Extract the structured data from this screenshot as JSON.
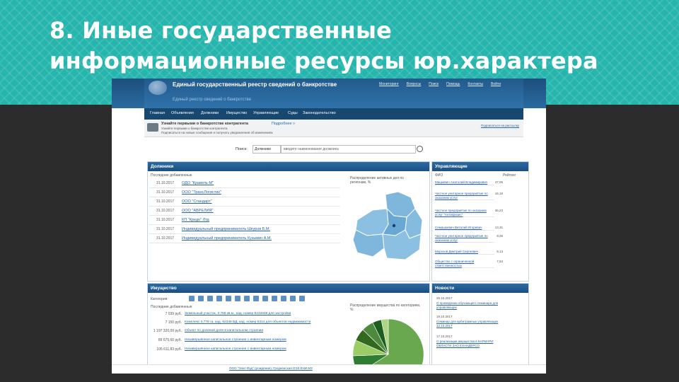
{
  "slide": {
    "title_line1": "8. Иные государственные",
    "title_line2": "информационные ресурсы юр.характера"
  },
  "site": {
    "title": "Единый государственный реестр сведений о банкротстве",
    "subtitle": "Единый реестр сведений о банкротстве",
    "top_links": [
      "Мониторинг",
      "Вопросы",
      "Поиск",
      "Помощь",
      "Контакты",
      "Войти"
    ],
    "nav": [
      "Главная",
      "Объявления",
      "Должники",
      "Имущество",
      "Управляющие",
      "Суды",
      "Законодательство"
    ]
  },
  "banner": {
    "title": "Узнайте первыми о банкротстве контрагента",
    "more": "Подробнее »",
    "line2": "Узнайте первыми о банкротстве контрагента",
    "line3": "Подписаться на новые сообщения и получать уведомления об изменениях",
    "right_link": "Подписаться на рассылку"
  },
  "search": {
    "label": "Поиск:",
    "scope": "Должники",
    "placeholder": "введите наименование должника"
  },
  "debtors": {
    "heading": "Должники",
    "recent_label": "Последние добавленные",
    "map_label": "Распределение активных дел по регионам, %",
    "rows": [
      {
        "date": "31.10.2017",
        "name": "ОДО \"Кравель-М\""
      },
      {
        "date": "31.10.2017",
        "name": "ООО \"ТрансЛогистик\""
      },
      {
        "date": "31.10.2017",
        "name": "ООО \"Стандарт\""
      },
      {
        "date": "31.10.2017",
        "name": "ООО \"АВРЕЛИЯ\""
      },
      {
        "date": "31.10.2017",
        "name": "КП \"Кредо\" Лтд"
      },
      {
        "date": "31.10.2017",
        "name": "Индивидуальный предприниматель Шкуров Б.М."
      },
      {
        "date": "31.10.2017",
        "name": "Индивидуальный предприниматель Кузьмин А.М."
      }
    ]
  },
  "managers": {
    "heading": "Управляющие",
    "col_name": "ФИО",
    "col_rating": "Рейтинг",
    "rows": [
      {
        "name": "Мацкевич Анатолий Владимирович",
        "rating": "47,06"
      },
      {
        "name": "Частное унитарное предприятие по оказанию услуг",
        "rating": "16,18"
      },
      {
        "name": "Частное предприятие по оказанию услуг \"Антикризис\"",
        "rating": "36,23"
      },
      {
        "name": "Семашкевич Виталий Игоревич",
        "rating": "13,31"
      },
      {
        "name": "Частное унитарное предприятие по оказанию услуг",
        "rating": "9,26"
      },
      {
        "name": "Морозов Дмитрий Сергеевич",
        "rating": "9,13"
      },
      {
        "name": "Общество с ограниченной ответственностью",
        "rating": "7,53"
      }
    ]
  },
  "property": {
    "heading": "Имущество",
    "category_label": "Категория:",
    "recent_label": "Последние добавленные",
    "chart_label": "Распределение имущества по категориям, %",
    "rows": [
      {
        "price": "7 039 руб.",
        "name": "Земельный участок, 3 768 кв.м., кад. номер 6232848 для застройки"
      },
      {
        "price": "7 150 руб.",
        "name": "Комплекс 0,778 га, кад. 62348 ВД, кад. номер 6314 для объектов недвижимости"
      },
      {
        "price": "1 197 320,09 руб.",
        "name": "Объект по долевой доле в капитальном строении"
      },
      {
        "price": "89 675,60 руб.",
        "name": "Незавершённое капитальное строение с инвентарным номером"
      },
      {
        "price": "105 611,83 руб.",
        "name": "Незавершённое капитальное строение с инвентарным номером"
      }
    ]
  },
  "news": {
    "heading": "Новости",
    "items": [
      {
        "date": "25.10.2017",
        "title": "О проведении обучающего семинара для управляющих"
      },
      {
        "date": "19.10.2017",
        "title": "Семинар для арбитражных управляющих 12.10.2017"
      },
      {
        "date": "17.10.2017",
        "title": "О реализации имущества в КАРМАРИ ОБЛАСТИ ЗАО ЕХАНДЕРСО"
      }
    ]
  },
  "footer": {
    "link": "ООО \"Элит-Фуд\" (рождение), Гродненская ОЭЗ ЕНИ МЗ"
  },
  "colors": {
    "teal_band": "#25b5ad",
    "site_blue": "#2b6aa0",
    "map_fill": "#7fb6dc",
    "pie": [
      "#6aa84f",
      "#2e7d32",
      "#9ccc65",
      "#33691e",
      "#4e8a3e",
      "#1b5e20",
      "#aed581"
    ]
  }
}
